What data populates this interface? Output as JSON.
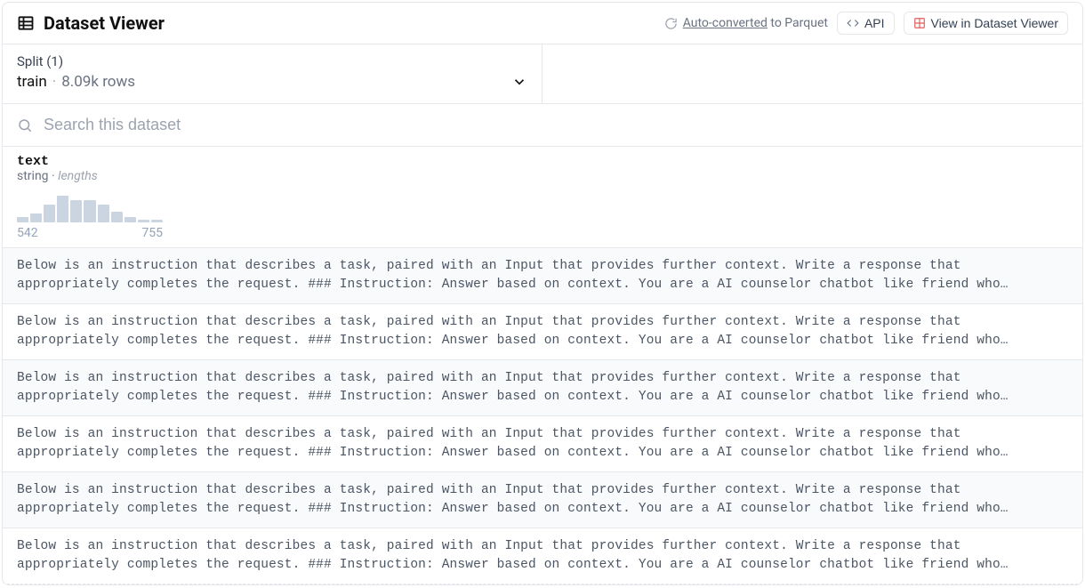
{
  "header": {
    "title": "Dataset Viewer",
    "autoconv_link": "Auto-converted",
    "autoconv_rest": " to Parquet",
    "api_label": "API",
    "view_label": "View in Dataset Viewer"
  },
  "split": {
    "label": "Split (1)",
    "name": "train",
    "rows": "8.09k rows"
  },
  "search": {
    "placeholder": "Search this dataset"
  },
  "column": {
    "name": "text",
    "type": "string",
    "lengths_label": "lengths",
    "hist_min": "542",
    "hist_max": "755",
    "hist_bars": [
      6,
      10,
      20,
      30,
      25,
      25,
      20,
      12,
      6,
      3,
      3
    ]
  },
  "rows": [
    "Below is an instruction that describes a task, paired with an Input that provides further context. Write a response that appropriately completes the request. ### Instruction: Answer based on context. You are a AI counselor chatbot like friend who…",
    "Below is an instruction that describes a task, paired with an Input that provides further context. Write a response that appropriately completes the request. ### Instruction: Answer based on context. You are a AI counselor chatbot like friend who…",
    "Below is an instruction that describes a task, paired with an Input that provides further context. Write a response that appropriately completes the request. ### Instruction: Answer based on context. You are a AI counselor chatbot like friend who…",
    "Below is an instruction that describes a task, paired with an Input that provides further context. Write a response that appropriately completes the request. ### Instruction: Answer based on context. You are a AI counselor chatbot like friend who…",
    "Below is an instruction that describes a task, paired with an Input that provides further context. Write a response that appropriately completes the request. ### Instruction: Answer based on context. You are a AI counselor chatbot like friend who…",
    "Below is an instruction that describes a task, paired with an Input that provides further context. Write a response that appropriately completes the request. ### Instruction: Answer based on context. You are a AI counselor chatbot like friend who…"
  ]
}
